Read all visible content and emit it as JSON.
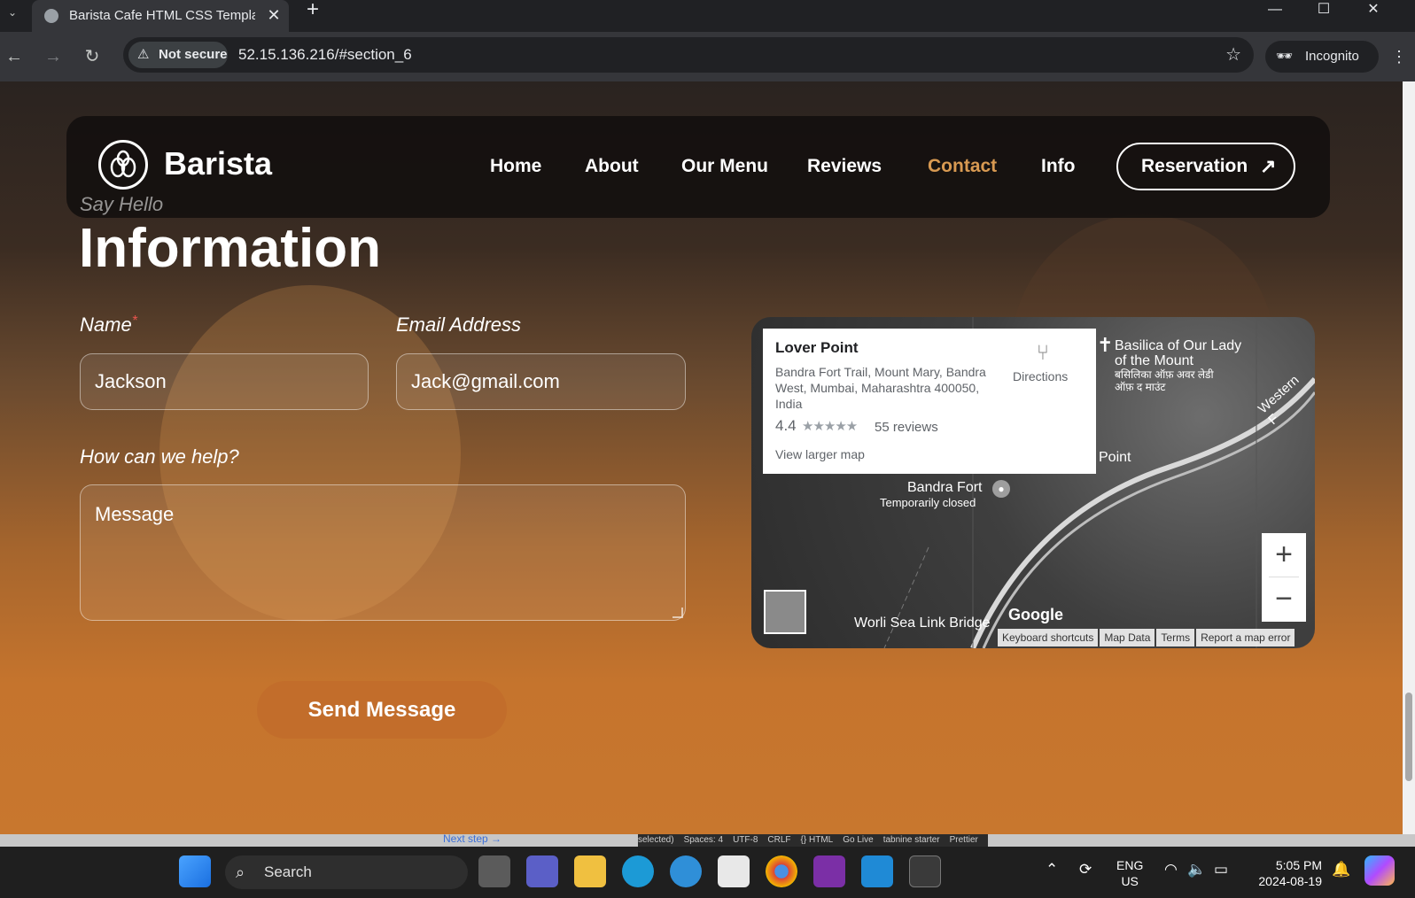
{
  "browser": {
    "tab_title": "Barista Cafe HTML CSS Template",
    "security_label": "Not secure",
    "url": "52.15.136.216/#section_6",
    "incognito_label": "Incognito"
  },
  "site": {
    "brand": "Barista",
    "nav": [
      "Home",
      "About",
      "Our Menu",
      "Reviews",
      "Contact",
      "Info"
    ],
    "active_nav": "Contact",
    "reservation_label": "Reservation",
    "accent_color": "#d89a52"
  },
  "contact": {
    "kicker": "Say Hello",
    "title": "Information",
    "name_label": "Name",
    "required_mark": "*",
    "name_value": "Jackson",
    "email_label": "Email Address",
    "email_value": "Jack@gmail.com",
    "help_label": "How can we help?",
    "message_placeholder": "Message",
    "send_label": "Send Message",
    "button_color": "#c26d2b"
  },
  "map": {
    "place_name": "Lover Point",
    "address": "Bandra Fort Trail, Mount Mary, Bandra West, Mumbai, Maharashtra 400050, India",
    "rating": "4.4",
    "stars": "★★★★★",
    "reviews": "55 reviews",
    "view_larger": "View larger map",
    "directions": "Directions",
    "labels": {
      "basilica": "Basilica of Our Lady of the Mount",
      "basilica_hindi": "बसिलिका ऑफ़ अवर लेडी ऑफ़ द माउंट",
      "point": "Point",
      "western": "Western F",
      "bandra_fort": "Bandra Fort",
      "temp_closed": "Temporarily closed",
      "sea_link": "Worli Sea Link Bridge",
      "google": "Google"
    },
    "footer": [
      "Keyboard shortcuts",
      "Map Data",
      "Terms",
      "Report a map error"
    ]
  },
  "editor_status": {
    "next_step": "Next step",
    "items": [
      "selected)",
      "Spaces: 4",
      "UTF-8",
      "CRLF",
      "{} HTML",
      "Go Live",
      "tabnine starter",
      "Prettier"
    ]
  },
  "taskbar": {
    "search_label": "Search",
    "lang_top": "ENG",
    "lang_bottom": "US",
    "time": "5:05 PM",
    "date": "2024-08-19"
  }
}
